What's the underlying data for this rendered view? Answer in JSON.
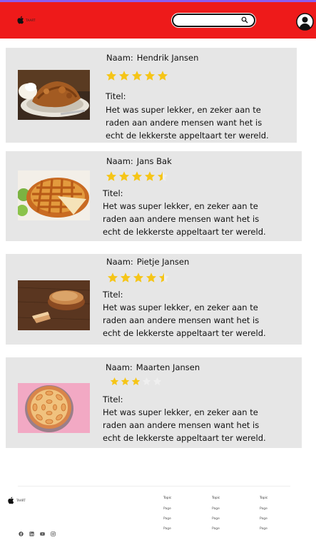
{
  "header": {
    "logo_text": "TAART",
    "search": {
      "placeholder": ""
    }
  },
  "reviews": [
    {
      "name_label": "Naam:",
      "name": "Hendrik Jansen",
      "rating": 5,
      "title_label": "Titel:",
      "text": "Het was super lekker, en zeker aan te raden aan andere mensen want het is echt de lekkerste appeltaart ter wereld.",
      "image": "apple-crumble-cream-photo"
    },
    {
      "name_label": "Naam:",
      "name": "Jans Bak",
      "rating": 4.5,
      "title_label": "Titel:",
      "text": "Het was super lekker, en zeker aan te raden aan andere mensen want het is echt de lekkerste appeltaart ter wereld.",
      "image": "lattice-apple-pie-photo"
    },
    {
      "name_label": "Naam:",
      "name": "Pietje Jansen",
      "rating": 4.5,
      "title_label": "Titel:",
      "text": "Het was super lekker, en zeker aan te raden aan andere mensen want het is echt de lekkerste appeltaart ter wereld.",
      "image": "crumble-pie-on-wood-photo"
    },
    {
      "name_label": "Naam:",
      "name": "Maarten Jansen",
      "rating": 3,
      "title_label": "Titel:",
      "text": "Het was super lekker, en zeker aan te raden aan andere mensen want het is echt de lekkerste appeltaart ter wereld.",
      "image": "apple-tart-pink-background-photo"
    }
  ],
  "colors": {
    "header_bg": "#ee1a1a",
    "star_filled": "#f5c518",
    "star_empty": "#efefef",
    "card_bg": "#e6e6e6"
  },
  "footer": {
    "logo_text": "TAART",
    "social_icons": [
      "facebook-icon",
      "linkedin-icon",
      "youtube-icon",
      "instagram-icon"
    ],
    "columns": [
      {
        "topic": "Topic",
        "pages": [
          "Page",
          "Page",
          "Page"
        ]
      },
      {
        "topic": "Topic",
        "pages": [
          "Page",
          "Page",
          "Page"
        ]
      },
      {
        "topic": "Topic",
        "pages": [
          "Page",
          "Page",
          "Page"
        ]
      }
    ]
  }
}
